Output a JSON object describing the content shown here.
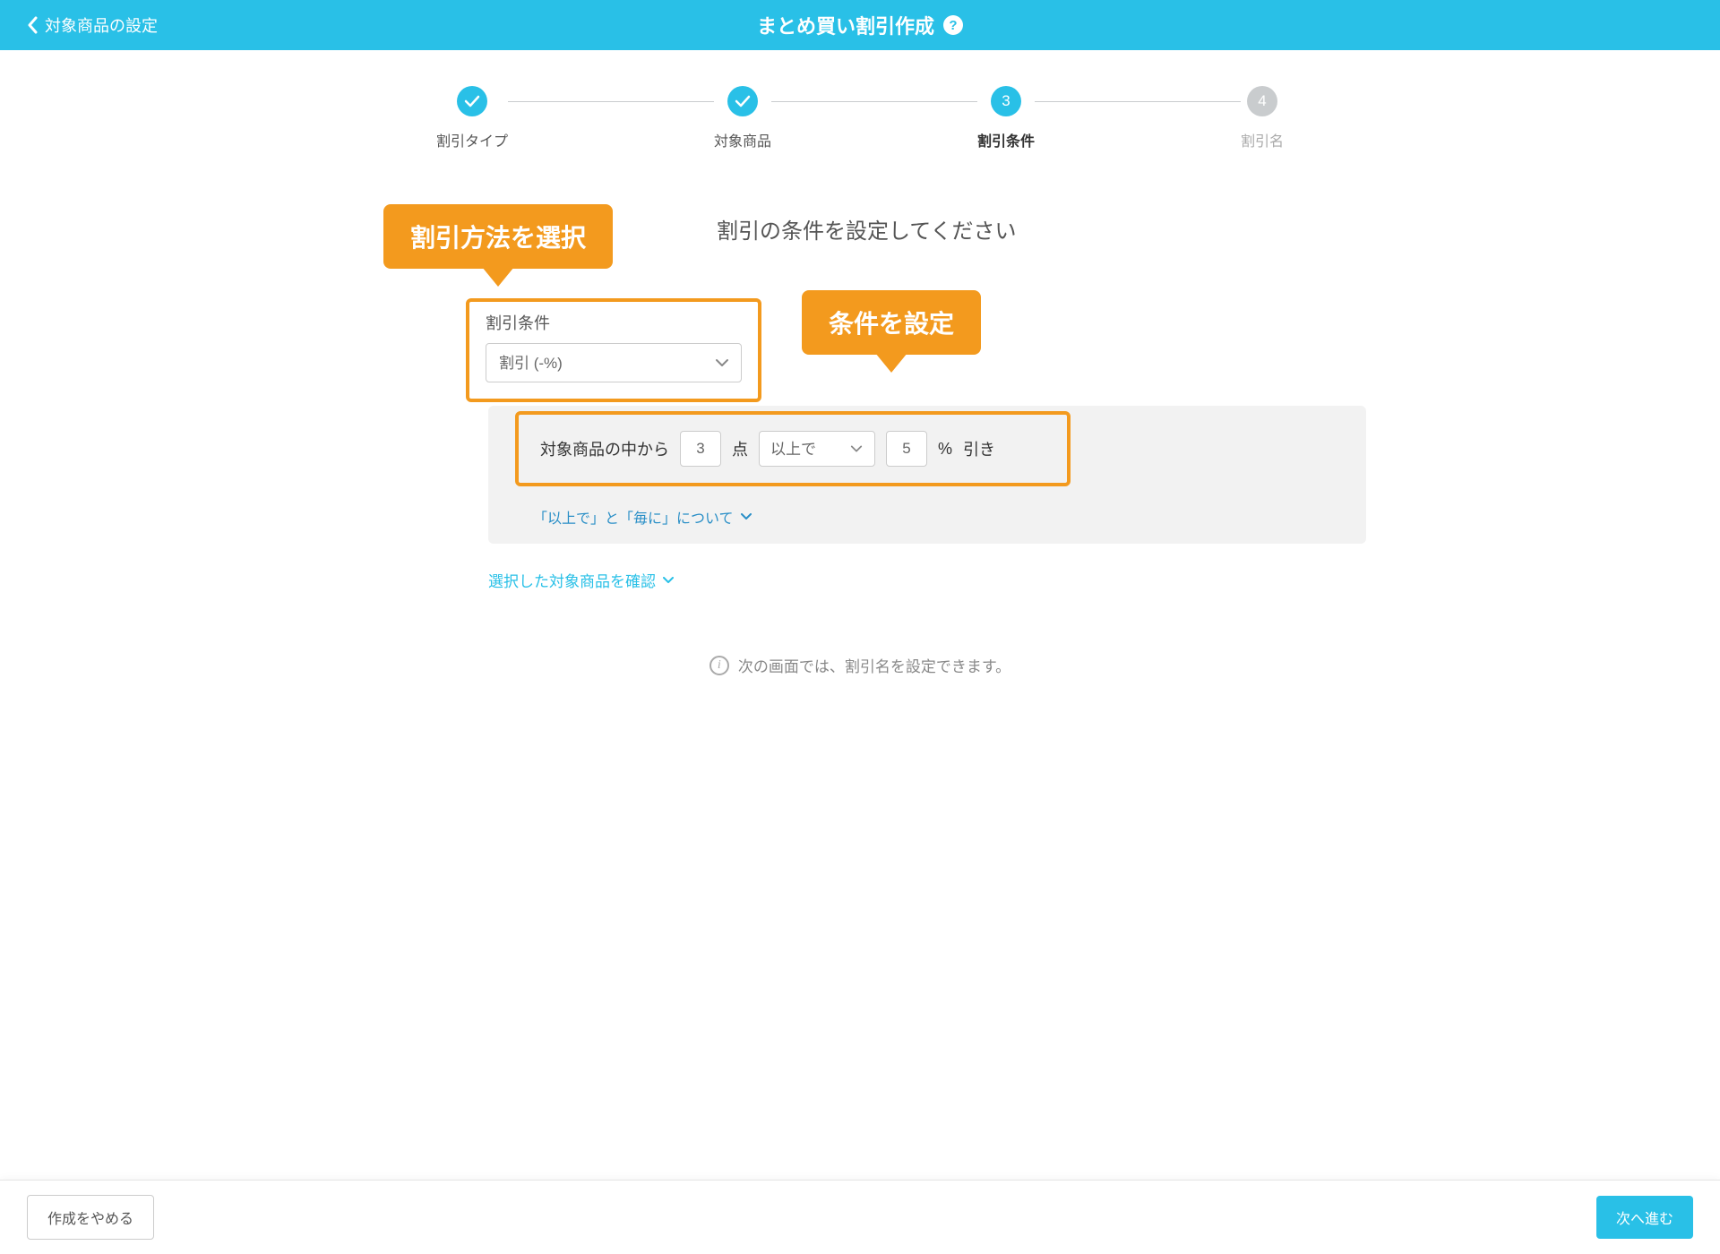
{
  "header": {
    "back_label": "対象商品の設定",
    "title": "まとめ買い割引作成"
  },
  "stepper": {
    "steps": [
      {
        "label": "割引タイプ",
        "state": "done",
        "indicator": "✓"
      },
      {
        "label": "対象商品",
        "state": "done",
        "indicator": "✓"
      },
      {
        "label": "割引条件",
        "state": "active",
        "indicator": "3"
      },
      {
        "label": "割引名",
        "state": "inactive",
        "indicator": "4"
      }
    ]
  },
  "callouts": {
    "method": "割引方法を選択",
    "condition": "条件を設定"
  },
  "section": {
    "title": "割引の条件を設定してください"
  },
  "discount_type": {
    "label": "割引条件",
    "selected": "割引 (-%)"
  },
  "condition": {
    "prefix": "対象商品の中から",
    "qty_value": "3",
    "qty_unit": "点",
    "operator_selected": "以上で",
    "percent_value": "5",
    "percent_symbol": "%",
    "suffix": "引き"
  },
  "links": {
    "about": "「以上で」と「毎に」について",
    "confirm": "選択した対象商品を確認"
  },
  "info": {
    "text": "次の画面では、割引名を設定できます。"
  },
  "footer": {
    "cancel": "作成をやめる",
    "next": "次へ進む"
  }
}
